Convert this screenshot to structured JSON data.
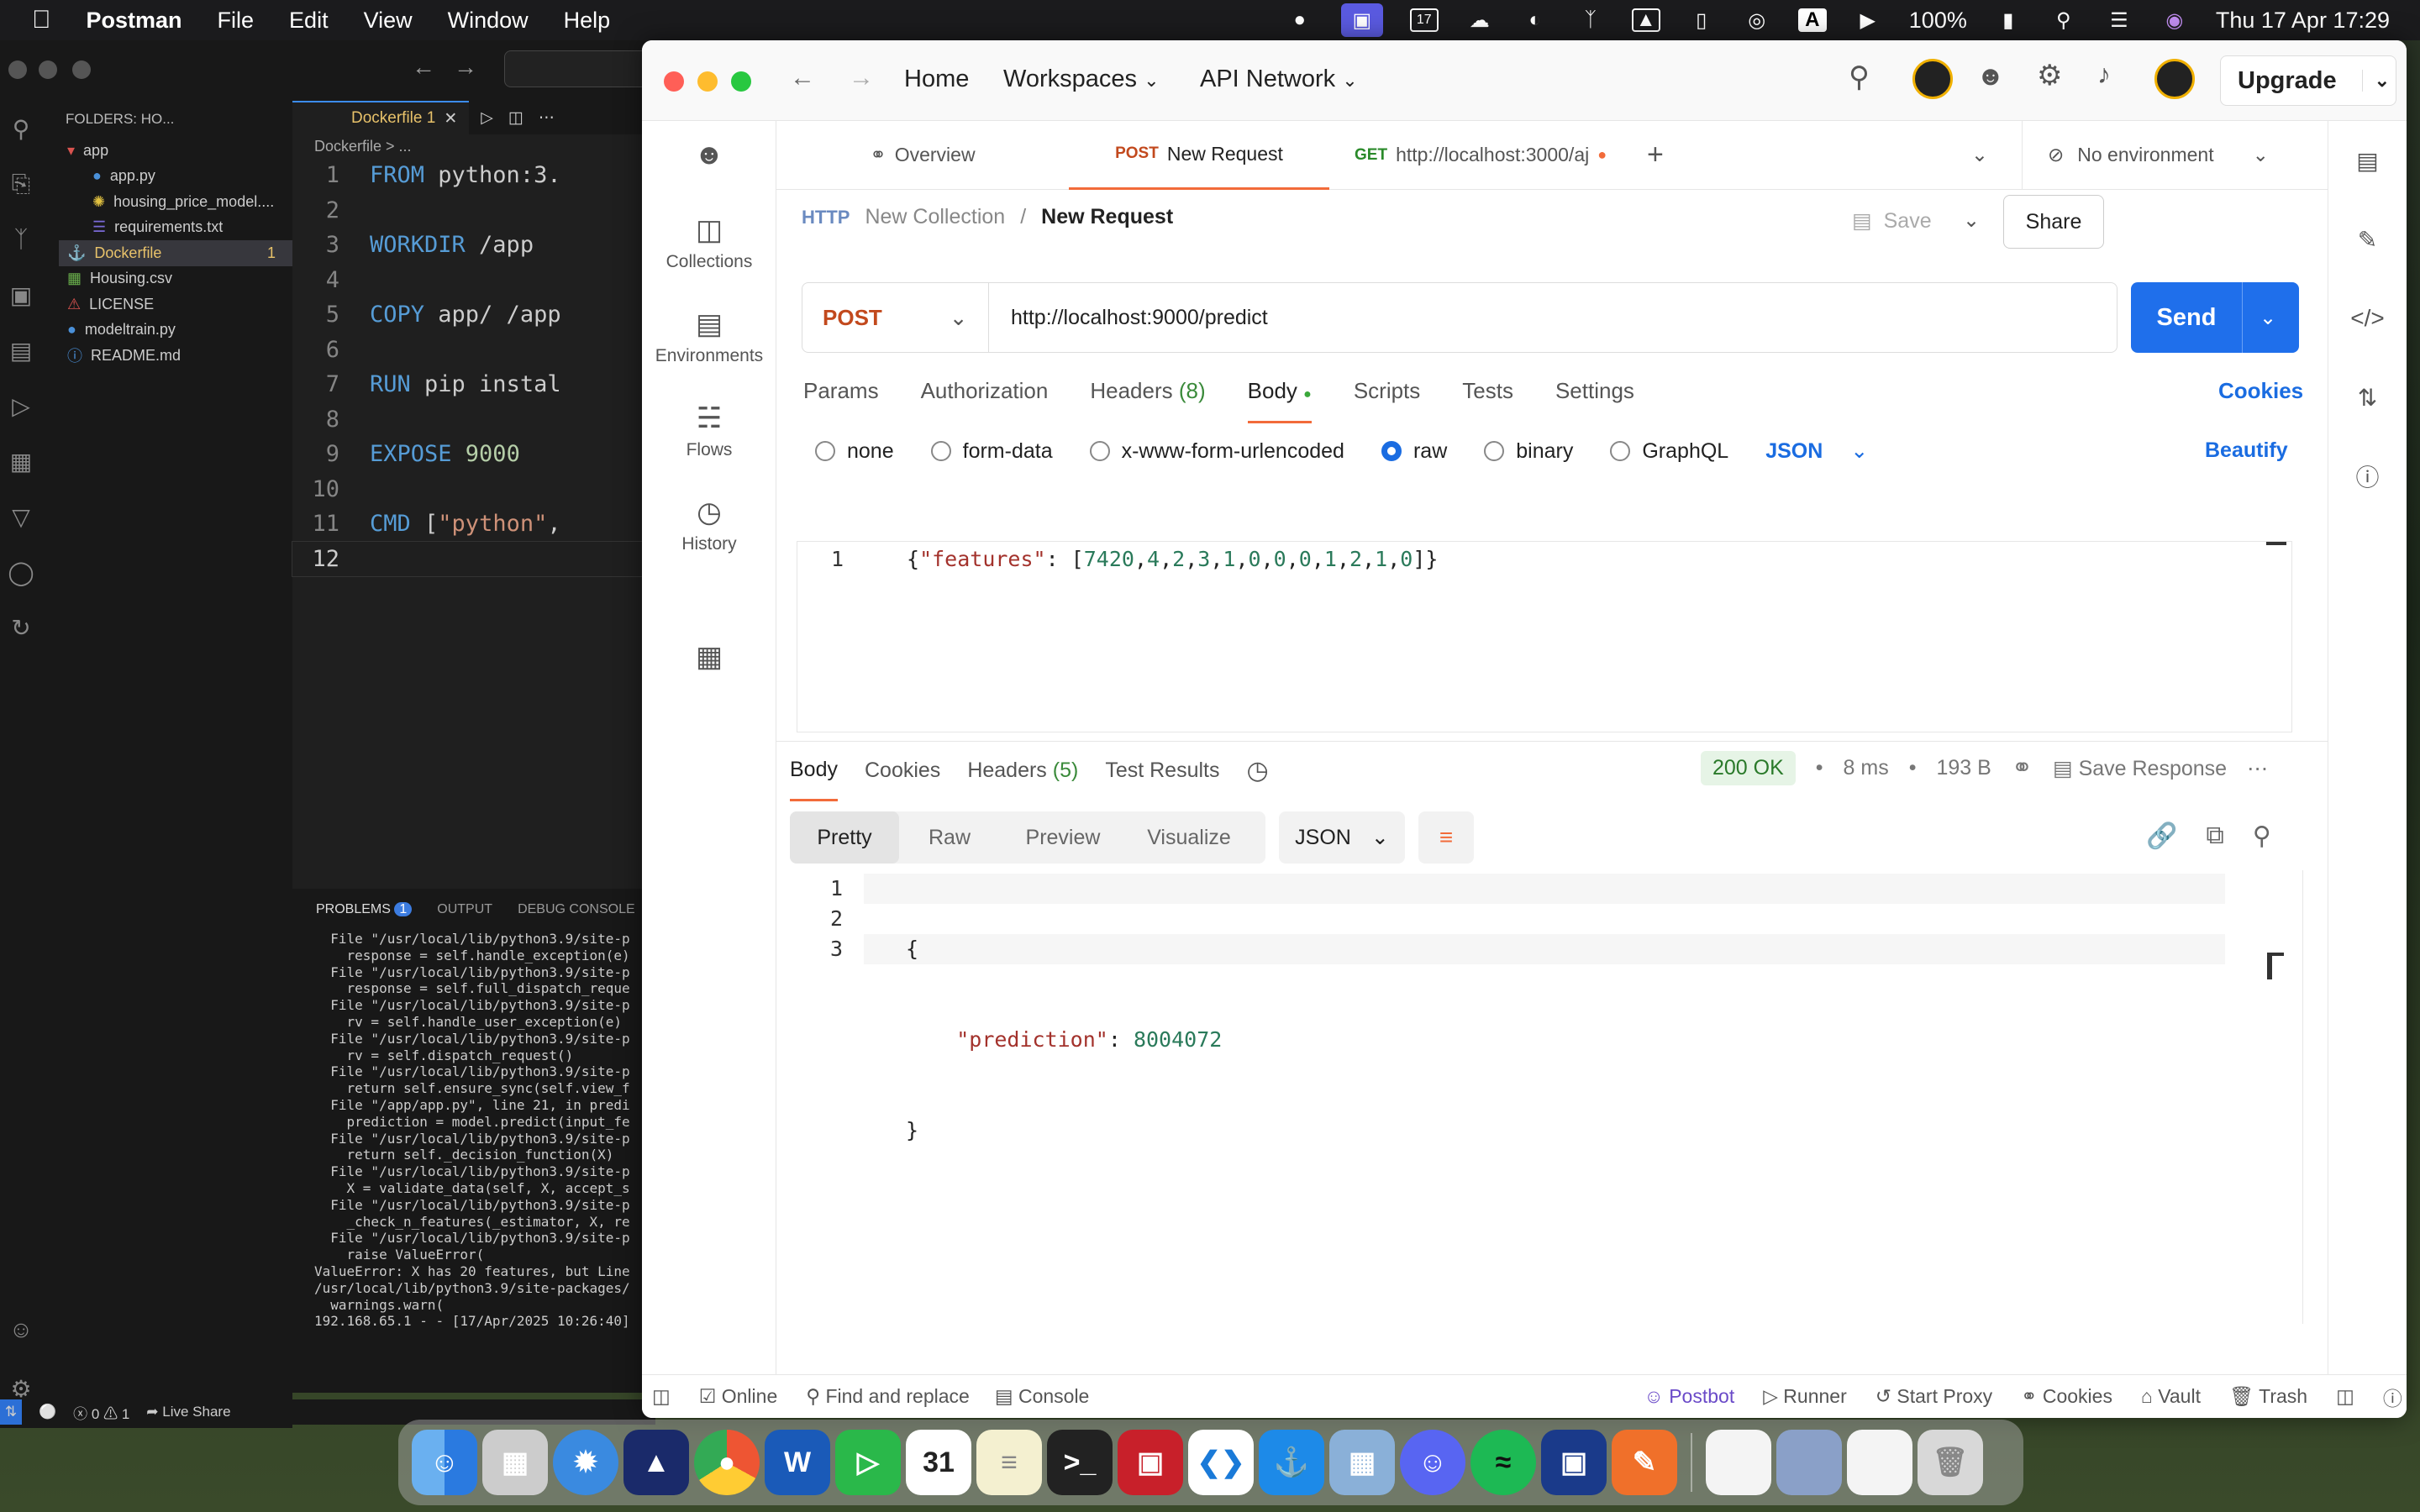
{
  "menubar": {
    "app_name": "Postman",
    "items": [
      "File",
      "Edit",
      "View",
      "Window",
      "Help"
    ],
    "battery": "100%",
    "datetime": "Thu 17 Apr  17:29",
    "calendar_day": "17",
    "keyboard_letter": "A"
  },
  "vscode": {
    "folders_label": "FOLDERS: HO...",
    "tree": [
      {
        "name": "app",
        "type": "folder",
        "indent": 0
      },
      {
        "name": "app.py",
        "type": "py",
        "indent": 1
      },
      {
        "name": "housing_price_model....",
        "type": "pkl",
        "indent": 1
      },
      {
        "name": "requirements.txt",
        "type": "txt",
        "indent": 1
      },
      {
        "name": "Dockerfile",
        "type": "docker",
        "indent": 0,
        "badge": "1"
      },
      {
        "name": "Housing.csv",
        "type": "csv",
        "indent": 0
      },
      {
        "name": "LICENSE",
        "type": "lic",
        "indent": 0
      },
      {
        "name": "modeltrain.py",
        "type": "py",
        "indent": 0
      },
      {
        "name": "README.md",
        "type": "md",
        "indent": 0
      }
    ],
    "tab_label": "Dockerfile 1",
    "breadcrumb": "Dockerfile > ...",
    "code": [
      {
        "n": "1",
        "parts": [
          [
            "kw",
            "FROM "
          ],
          [
            "tx",
            "python:3."
          ]
        ]
      },
      {
        "n": "2",
        "parts": []
      },
      {
        "n": "3",
        "parts": [
          [
            "kw",
            "WORKDIR "
          ],
          [
            "tx",
            "/app"
          ]
        ]
      },
      {
        "n": "4",
        "parts": []
      },
      {
        "n": "5",
        "parts": [
          [
            "kw",
            "COPY "
          ],
          [
            "tx",
            "app/ /app"
          ]
        ]
      },
      {
        "n": "6",
        "parts": []
      },
      {
        "n": "7",
        "parts": [
          [
            "kw",
            "RUN "
          ],
          [
            "tx",
            "pip instal"
          ]
        ]
      },
      {
        "n": "8",
        "parts": []
      },
      {
        "n": "9",
        "parts": [
          [
            "kw",
            "EXPOSE "
          ],
          [
            "num",
            "9000"
          ]
        ]
      },
      {
        "n": "10",
        "parts": []
      },
      {
        "n": "11",
        "parts": [
          [
            "kw",
            "CMD "
          ],
          [
            "tx",
            "["
          ],
          [
            "str",
            "\"python\""
          ],
          [
            "tx",
            ","
          ]
        ]
      },
      {
        "n": "12",
        "parts": []
      }
    ],
    "panel_tabs": {
      "problems": "PROBLEMS",
      "problems_count": "1",
      "output": "OUTPUT",
      "debug": "DEBUG CONSOLE"
    },
    "terminal": "  File \"/usr/local/lib/python3.9/site-p\n    response = self.handle_exception(e)\n  File \"/usr/local/lib/python3.9/site-p\n    response = self.full_dispatch_reque\n  File \"/usr/local/lib/python3.9/site-p\n    rv = self.handle_user_exception(e)\n  File \"/usr/local/lib/python3.9/site-p\n    rv = self.dispatch_request()\n  File \"/usr/local/lib/python3.9/site-p\n    return self.ensure_sync(self.view_f\n  File \"/app/app.py\", line 21, in predi\n    prediction = model.predict(input_fe\n  File \"/usr/local/lib/python3.9/site-p\n    return self._decision_function(X)\n  File \"/usr/local/lib/python3.9/site-p\n    X = validate_data(self, X, accept_s\n  File \"/usr/local/lib/python3.9/site-p\n    _check_n_features(_estimator, X, re\n  File \"/usr/local/lib/python3.9/site-p\n    raise ValueError(\nValueError: X has 20 features, but Line\n/usr/local/lib/python3.9/site-packages/\n  warnings.warn(\n192.168.65.1 - - [17/Apr/2025 10:26:40]",
    "status": {
      "errors": "0",
      "warnings": "1",
      "live_share": "Live Share"
    }
  },
  "postman": {
    "nav": {
      "home": "Home",
      "workspaces": "Workspaces",
      "api_network": "API Network",
      "upgrade": "Upgrade"
    },
    "sidebar": [
      {
        "label": "",
        "icon": "people-icon"
      },
      {
        "label": "Collections",
        "icon": "collections-icon"
      },
      {
        "label": "Environments",
        "icon": "environments-icon"
      },
      {
        "label": "Flows",
        "icon": "flows-icon"
      },
      {
        "label": "History",
        "icon": "history-icon"
      },
      {
        "label": "",
        "icon": "apps-icon"
      }
    ],
    "tabs": {
      "overview": "Overview",
      "active_method": "POST",
      "active_label": "New Request",
      "other_method": "GET",
      "other_label": "http://localhost:3000/aj"
    },
    "environment": "No environment",
    "breadcrumb": {
      "collection": "New Collection",
      "sep": "/",
      "request": "New Request"
    },
    "save": "Save",
    "share": "Share",
    "method": "POST",
    "url": "http://localhost:9000/predict",
    "send": "Send",
    "req_tabs": {
      "params": "Params",
      "auth": "Authorization",
      "headers": "Headers",
      "headers_count": "(8)",
      "body": "Body",
      "scripts": "Scripts",
      "tests": "Tests",
      "settings": "Settings",
      "cookies": "Cookies"
    },
    "body_types": {
      "none": "none",
      "form": "form-data",
      "urlenc": "x-www-form-urlencoded",
      "raw": "raw",
      "binary": "binary",
      "graphql": "GraphQL",
      "format": "JSON",
      "beautify": "Beautify"
    },
    "request_body": {
      "line": "1",
      "key": "\"features\"",
      "values": [
        "7420",
        "4",
        "2",
        "3",
        "1",
        "0",
        "0",
        "0",
        "1",
        "2",
        "1",
        "0"
      ]
    },
    "response": {
      "tabs": {
        "body": "Body",
        "cookies": "Cookies",
        "headers": "Headers",
        "headers_count": "(5)",
        "tests": "Test Results"
      },
      "status": "200 OK",
      "time": "8 ms",
      "size": "193 B",
      "save": "Save Response",
      "views": {
        "pretty": "Pretty",
        "raw": "Raw",
        "preview": "Preview",
        "visualize": "Visualize",
        "format": "JSON"
      },
      "lines": [
        {
          "n": "1",
          "text": "{"
        },
        {
          "n": "2",
          "key": "\"prediction\"",
          "value": "8004072"
        },
        {
          "n": "3",
          "text": "}"
        }
      ]
    },
    "statusbar": {
      "online": "Online",
      "find": "Find and replace",
      "console": "Console",
      "postbot": "Postbot",
      "runner": "Runner",
      "proxy": "Start Proxy",
      "cookies": "Cookies",
      "vault": "Vault",
      "trash": "Trash"
    }
  },
  "dock": {
    "calendar_day": "31",
    "items": [
      "finder",
      "launchpad",
      "safari",
      "affinity",
      "chrome",
      "word",
      "facetime",
      "calendar",
      "notes",
      "terminal",
      "photobooth",
      "vscode",
      "docker",
      "preview",
      "discord",
      "spotify",
      "postman",
      "pages",
      "doc-thumb-1",
      "doc-thumb-2",
      "doc-thumb-3",
      "trash"
    ]
  }
}
